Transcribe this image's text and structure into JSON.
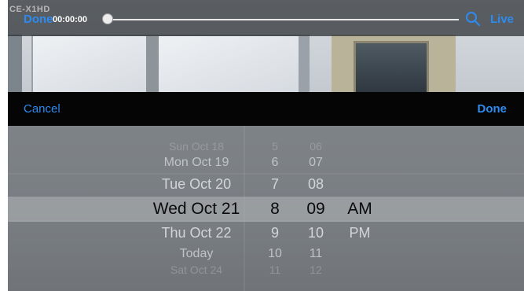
{
  "camera": {
    "label": "CE-X1HD"
  },
  "player": {
    "done_label": "Done",
    "timecode": "00:00:00",
    "progress": 0.0,
    "live_label": "Live",
    "search_icon": "search-icon"
  },
  "picker_toolbar": {
    "cancel_label": "Cancel",
    "done_label": "Done"
  },
  "date_picker": {
    "dates": [
      "Sun Oct 18",
      "Mon Oct 19",
      "Tue Oct 20",
      "Wed Oct 21",
      "Thu Oct 22",
      "Today",
      "Sat Oct 24"
    ],
    "hours": [
      "5",
      "6",
      "7",
      "8",
      "9",
      "10",
      "11"
    ],
    "minutes": [
      "06",
      "07",
      "08",
      "09",
      "10",
      "11",
      "12"
    ],
    "ampm": [
      "AM",
      "PM"
    ],
    "selected": {
      "date": "Wed Oct 21",
      "hour": "8",
      "minute": "09",
      "ampm": "AM"
    }
  },
  "colors": {
    "accent": "#2d8bf0",
    "toolbar": "#050505"
  }
}
